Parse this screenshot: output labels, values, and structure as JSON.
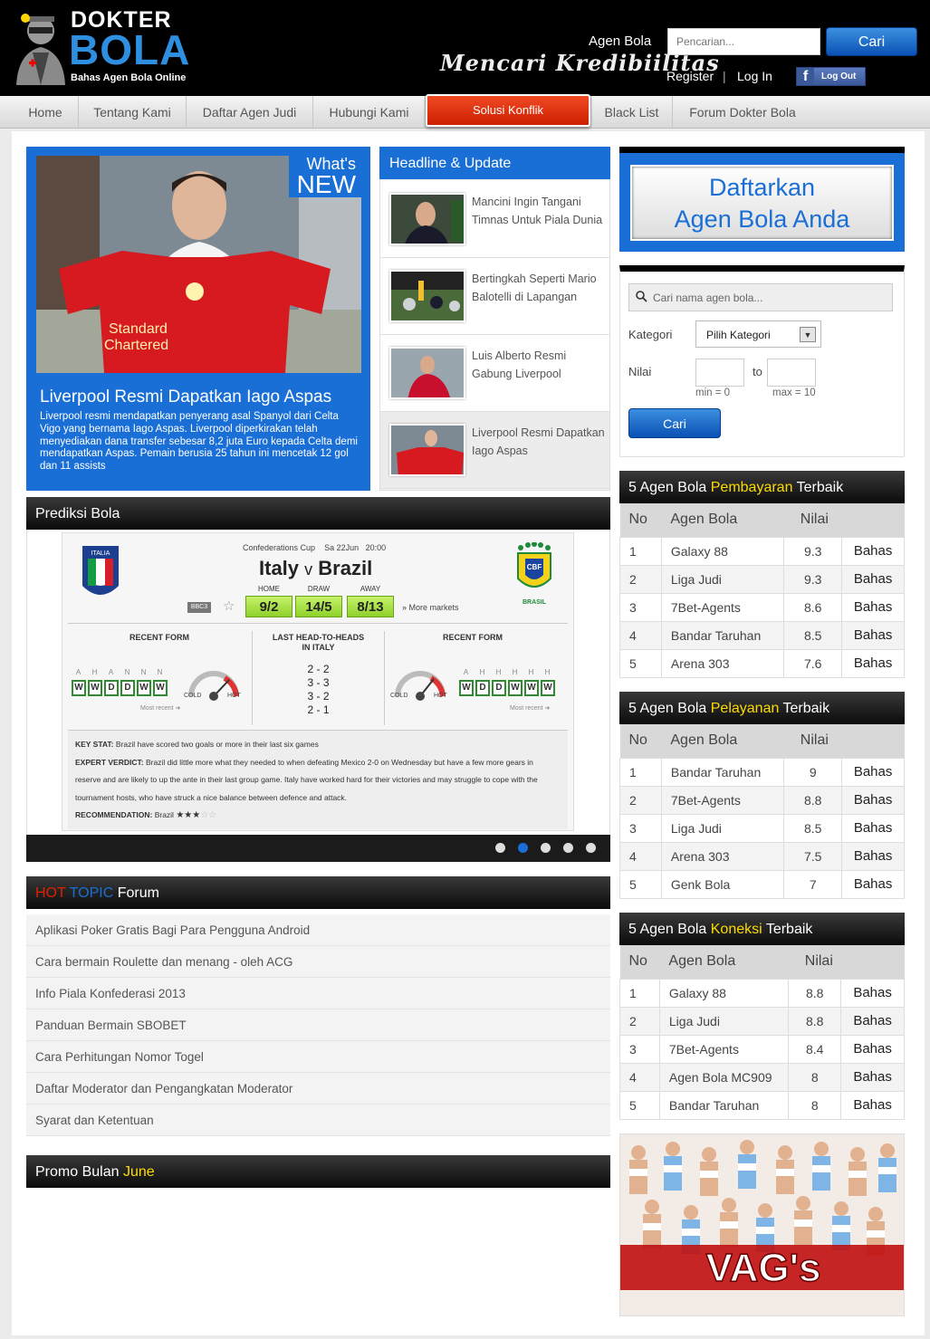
{
  "header": {
    "logo_top": "DOKTER",
    "logo_main": "BOLA",
    "logo_tagline": "Bahas Agen Bola Online",
    "search_label": "Agen Bola",
    "search_placeholder": "Pencarian...",
    "search_button": "Cari",
    "slogan": "Mencari Kredibiilitas",
    "register": "Register",
    "separator": "|",
    "login": "Log In",
    "fb_button": "Log Out",
    "fb_icon_glyph": "f"
  },
  "nav": {
    "items": [
      "Home",
      "Tentang Kami",
      "Daftar Agen Judi",
      "Hubungi Kami",
      "Solusi Konflik",
      "Black List",
      "Forum Dokter Bola"
    ]
  },
  "whats_new": {
    "badge_top": "What's",
    "badge_bottom": "NEW",
    "shirt_text_1": "Standard",
    "shirt_text_2": "Chartered",
    "title": "Liverpool Resmi Dapatkan Iago Aspas",
    "text": "Liverpool resmi mendapatkan penyerang asal Spanyol dari Celta Vigo yang bernama Iago Aspas. Liverpool diperkirakan telah menyediakan dana transfer sebesar 8,2 juta Euro kepada Celta demi mendapatkan Aspas. Pemain berusia 25 tahun ini mencetak 12 gol dan 11 assists"
  },
  "headline": {
    "title": "Headline & Update",
    "items": [
      "Mancini Ingin Tangani Timnas Untuk Piala Dunia",
      "Bertingkah Seperti Mario Balotelli di Lapangan",
      "Luis Alberto Resmi Gabung Liverpool",
      "Liverpool Resmi Dapatkan Iago Aspas"
    ]
  },
  "prediksi": {
    "title": "Prediksi Bola",
    "competition": "Confederations Cup",
    "date": "Sa 22Jun",
    "time": "20:00",
    "home_team": "Italy",
    "vs": "v",
    "away_team": "Brazil",
    "italia_label": "ITALIA",
    "brasil_label": "BRASIL",
    "cbf_label": "CBF",
    "channel": "BBC3",
    "odds_labels": [
      "HOME",
      "DRAW",
      "AWAY"
    ],
    "odds_values": [
      "9/2",
      "14/5",
      "8/13"
    ],
    "more_markets": "» More markets",
    "recent_form_label": "RECENT FORM",
    "h2h_label_1": "LAST HEAD-TO-HEADS",
    "h2h_label_2": "IN ITALY",
    "h2h_scores": [
      "2 - 2",
      "3 - 3",
      "3 - 2",
      "2 - 1"
    ],
    "italy_venues": [
      "A",
      "H",
      "A",
      "N",
      "N",
      "N"
    ],
    "italy_form": [
      "W",
      "W",
      "D",
      "D",
      "W",
      "W"
    ],
    "brazil_venues": [
      "A",
      "H",
      "H",
      "H",
      "H",
      "H"
    ],
    "brazil_form": [
      "W",
      "D",
      "D",
      "W",
      "W",
      "W"
    ],
    "most_recent": "Most recent ➜",
    "cold": "COLD",
    "hot": "HOT",
    "key_stat_label": "KEY STAT:",
    "key_stat": "Brazil have scored two goals or more in their last six games",
    "verdict_label": "EXPERT VERDICT:",
    "verdict": "Brazil did little more what they needed to when defeating Mexico 2-0 on Wednesday but have a few more gears in reserve and are likely to up the ante in their last group game. Italy have worked hard for their victories and may struggle to cope with the tournament hosts, who have struck a nice balance between defence and attack.",
    "recommendation_label": "RECOMMENDATION:",
    "recommendation": "Brazil",
    "stars_filled": "★★★",
    "stars_empty": "☆☆",
    "slides": 5,
    "active_slide": 2
  },
  "hot_topic": {
    "title_hot": "HOT",
    "title_topic": "TOPIC",
    "title_forum": "Forum",
    "items": [
      "Aplikasi Poker Gratis Bagi Para Pengguna Android",
      "Cara bermain Roulette dan menang - oleh ACG",
      "Info Piala Konfederasi 2013",
      "Panduan Bermain SBOBET",
      "Cara Perhitungan Nomor Togel",
      "Daftar Moderator dan Pengangkatan Moderator",
      "Syarat dan Ketentuan"
    ]
  },
  "promo": {
    "title_prefix": "Promo Bulan",
    "month": "June"
  },
  "sidebar": {
    "daftar_line1": "Daftarkan",
    "daftar_line2": "Agen Bola Anda",
    "search_placeholder": "Cari nama agen bola...",
    "kategori_label": "Kategori",
    "kategori_value": "Pilih Kategori",
    "nilai_label": "Nilai",
    "to_label": "to",
    "min_label": "min = 0",
    "max_label": "max = 10",
    "cari_button": "Cari",
    "columns": [
      "No",
      "Agen Bola",
      "Nilai"
    ],
    "bahas": "Bahas",
    "tables": [
      {
        "prefix": "5 Agen Bola",
        "highlight": "Pembayaran",
        "suffix": "Terbaik",
        "rows": [
          [
            "1",
            "Galaxy 88",
            "9.3"
          ],
          [
            "2",
            "Liga Judi",
            "9.3"
          ],
          [
            "3",
            "7Bet-Agents",
            "8.6"
          ],
          [
            "4",
            "Bandar Taruhan",
            "8.5"
          ],
          [
            "5",
            "Arena 303",
            "7.6"
          ]
        ]
      },
      {
        "prefix": "5 Agen Bola",
        "highlight": "Pelayanan",
        "suffix": "Terbaik",
        "rows": [
          [
            "1",
            "Bandar Taruhan",
            "9"
          ],
          [
            "2",
            "7Bet-Agents",
            "8.8"
          ],
          [
            "3",
            "Liga Judi",
            "8.5"
          ],
          [
            "4",
            "Arena 303",
            "7.5"
          ],
          [
            "5",
            "Genk Bola",
            "7"
          ]
        ]
      },
      {
        "prefix": "5 Agen Bola",
        "highlight": "Koneksi",
        "suffix": "Terbaik",
        "rows": [
          [
            "1",
            "Galaxy 88",
            "8.8"
          ],
          [
            "2",
            "Liga Judi",
            "8.8"
          ],
          [
            "3",
            "7Bet-Agents",
            "8.4"
          ],
          [
            "4",
            "Agen Bola MC909",
            "8"
          ],
          [
            "5",
            "Bandar Taruhan",
            "8"
          ]
        ]
      }
    ],
    "ad_text": "VAG's"
  },
  "colors": {
    "blue": "#1a6fd6",
    "red": "#e02000",
    "yellow": "#fddb00",
    "form_green": "#2e8b2e"
  }
}
